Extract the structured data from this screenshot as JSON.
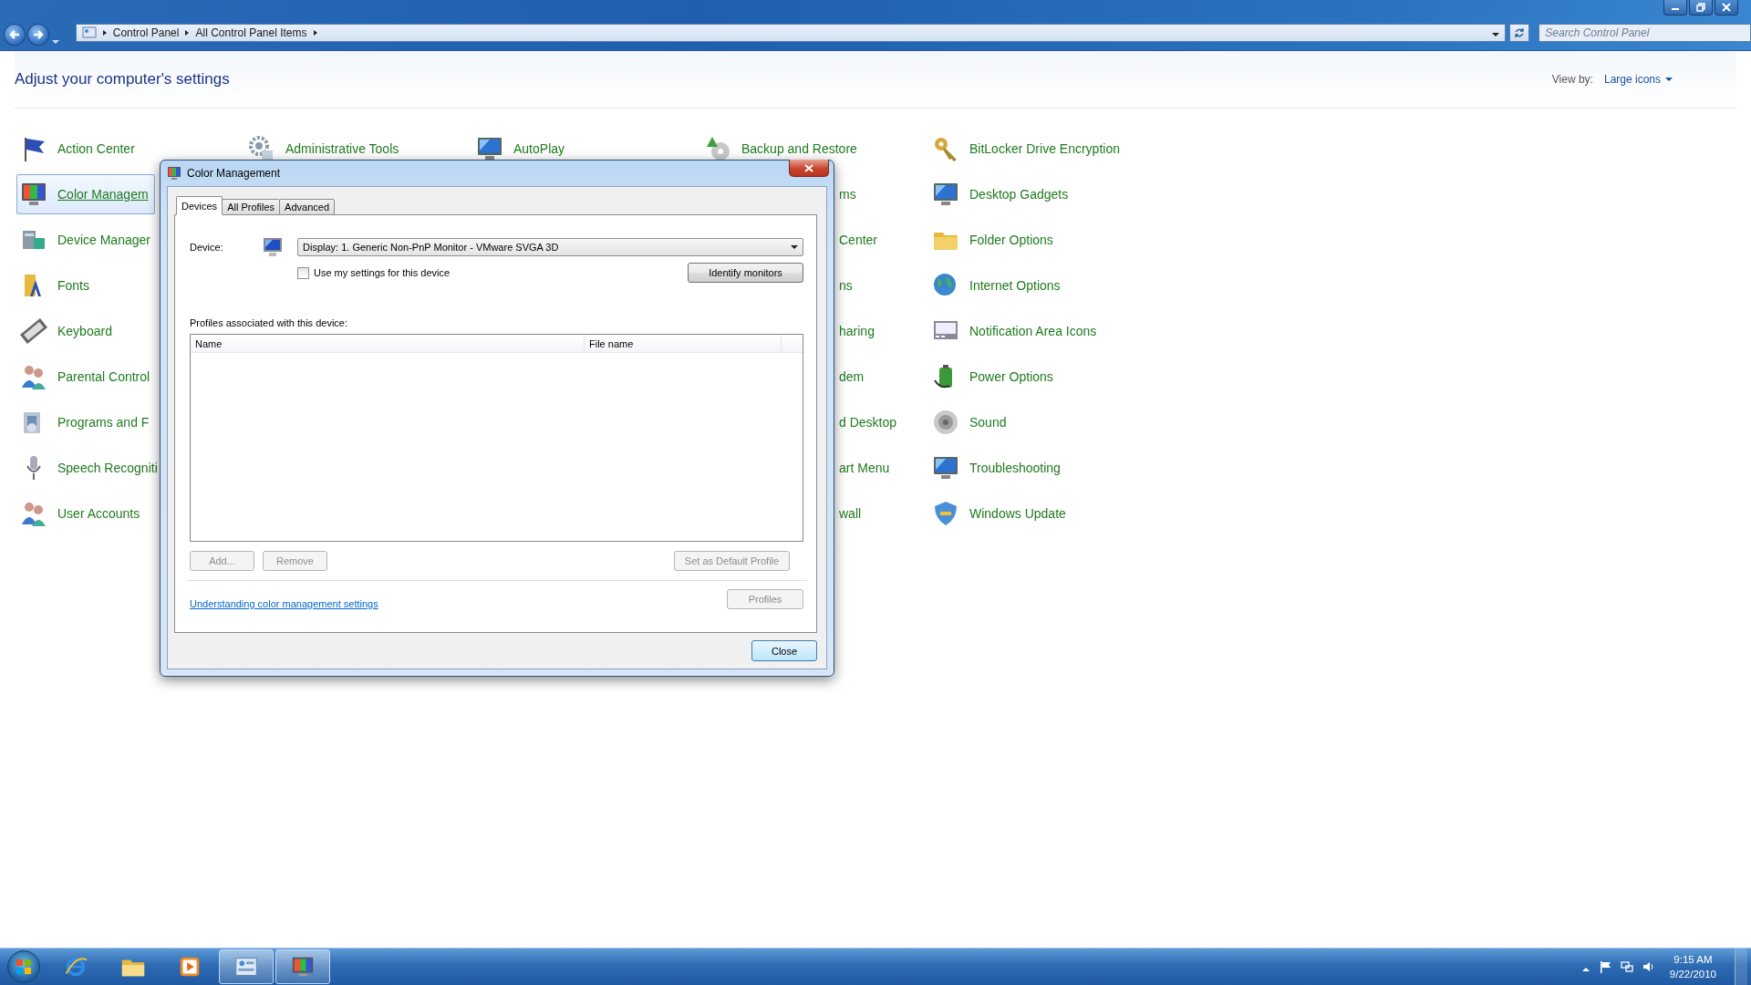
{
  "window": {
    "breadcrumb": [
      "Control Panel",
      "All Control Panel Items"
    ],
    "search": {
      "placeholder": "Search Control Panel"
    }
  },
  "header": {
    "title": "Adjust your computer's settings",
    "view_by_label": "View by:",
    "view_by_value": "Large icons"
  },
  "columns": [
    {
      "items": [
        {
          "label": "Action Center",
          "kind": "full",
          "selected": false
        },
        {
          "label": "Color Managem",
          "kind": "full",
          "selected": true
        },
        {
          "label": "Device Manager",
          "kind": "full",
          "selected": false
        },
        {
          "label": "Fonts",
          "kind": "full",
          "selected": false
        },
        {
          "label": "Keyboard",
          "kind": "full",
          "selected": false
        },
        {
          "label": "Parental Control",
          "kind": "full",
          "selected": false
        },
        {
          "label": "Programs and F",
          "kind": "full",
          "selected": false
        },
        {
          "label": "Speech Recogniti",
          "kind": "full",
          "selected": false
        },
        {
          "label": "User Accounts",
          "kind": "full",
          "selected": false
        }
      ]
    },
    {
      "items": [
        {
          "label": "Administrative Tools",
          "kind": "full",
          "selected": false
        }
      ]
    },
    {
      "items": [
        {
          "label": "AutoPlay",
          "kind": "full",
          "selected": false
        }
      ]
    },
    {
      "items": [
        {
          "label": "Backup and Restore",
          "kind": "full",
          "selected": false
        },
        {
          "label": "ms",
          "kind": "partial"
        },
        {
          "label": "Center",
          "kind": "partial"
        },
        {
          "label": "ns",
          "kind": "partial"
        },
        {
          "label": "haring",
          "kind": "partial"
        },
        {
          "label": "dem",
          "kind": "partial"
        },
        {
          "label": "d Desktop",
          "kind": "partial"
        },
        {
          "label": "art Menu",
          "kind": "partial"
        },
        {
          "label": "wall",
          "kind": "partial"
        }
      ]
    },
    {
      "items": [
        {
          "label": "BitLocker Drive Encryption",
          "kind": "full",
          "selected": false
        },
        {
          "label": "Desktop Gadgets",
          "kind": "full",
          "selected": false
        },
        {
          "label": "Folder Options",
          "kind": "full",
          "selected": false
        },
        {
          "label": "Internet Options",
          "kind": "full",
          "selected": false
        },
        {
          "label": "Notification Area Icons",
          "kind": "full",
          "selected": false
        },
        {
          "label": "Power Options",
          "kind": "full",
          "selected": false
        },
        {
          "label": "Sound",
          "kind": "full",
          "selected": false
        },
        {
          "label": "Troubleshooting",
          "kind": "full",
          "selected": false
        },
        {
          "label": "Windows Update",
          "kind": "full",
          "selected": false
        }
      ]
    }
  ],
  "dialog": {
    "title": "Color Management",
    "tabs": [
      {
        "label": "Devices",
        "selected": true
      },
      {
        "label": "All Profiles",
        "selected": false
      },
      {
        "label": "Advanced",
        "selected": false
      }
    ],
    "device_label": "Device:",
    "device_value": "Display: 1. Generic Non-PnP Monitor - VMware SVGA 3D",
    "checkbox": {
      "label": "Use my settings for this device",
      "checked": false
    },
    "identify_button": "Identify monitors",
    "profiles_label": "Profiles associated with this device:",
    "list_columns": [
      "Name",
      "File name"
    ],
    "buttons": [
      {
        "label": "Add...",
        "disabled": true
      },
      {
        "label": "Remove",
        "disabled": true
      },
      {
        "label": "Set as Default Profile",
        "disabled": true
      }
    ],
    "link": "Understanding color management settings",
    "profiles_button": {
      "label": "Profiles",
      "disabled": true
    },
    "close_button": "Close"
  },
  "taskbar": {
    "apps": [
      {
        "selected": false
      },
      {
        "selected": false
      },
      {
        "selected": false
      },
      {
        "selected": true
      },
      {
        "selected": true
      }
    ],
    "time": "9:15 AM",
    "date": "9/22/2010"
  }
}
